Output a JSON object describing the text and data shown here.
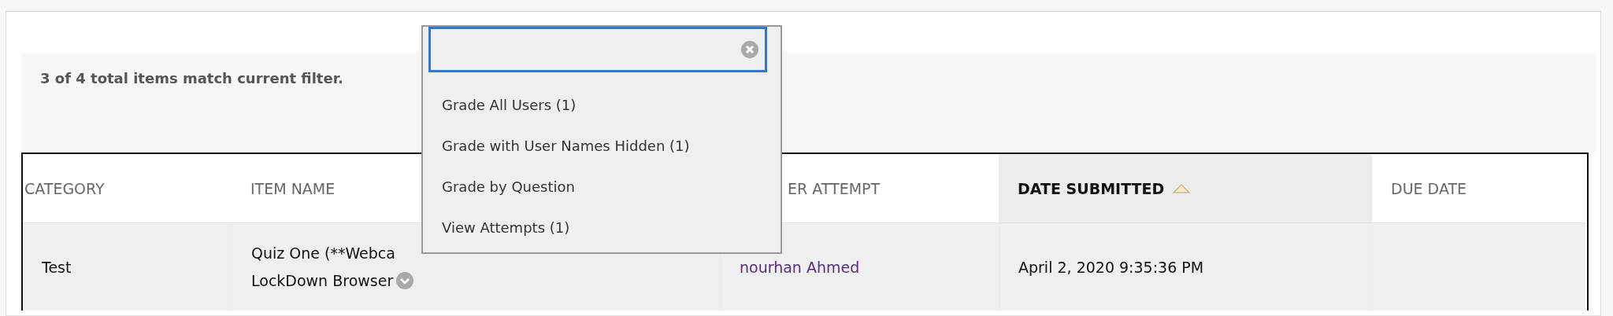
{
  "filter_message": "3 of 4 total items match current filter.",
  "table": {
    "columns": [
      {
        "label": "CATEGORY",
        "sorted": false
      },
      {
        "label": "ITEM NAME",
        "sorted": false
      },
      {
        "label": "ER ATTEMPT",
        "sorted": false
      },
      {
        "label": "DATE SUBMITTED",
        "sorted": true
      },
      {
        "label": "DUE DATE",
        "sorted": false
      }
    ],
    "rows": [
      {
        "category": "Test",
        "item_name_lines": [
          "Quiz One (**Webca",
          "LockDown Browser"
        ],
        "user": "nourhan Ahmed",
        "date_submitted": "April 2, 2020 9:35:36 PM"
      }
    ]
  },
  "menu": {
    "items": [
      {
        "label": "Grade All Users (1)"
      },
      {
        "label": "Grade with User Names Hidden (1)"
      },
      {
        "label": "Grade by Question"
      },
      {
        "label": "View Attempts (1)"
      }
    ]
  }
}
